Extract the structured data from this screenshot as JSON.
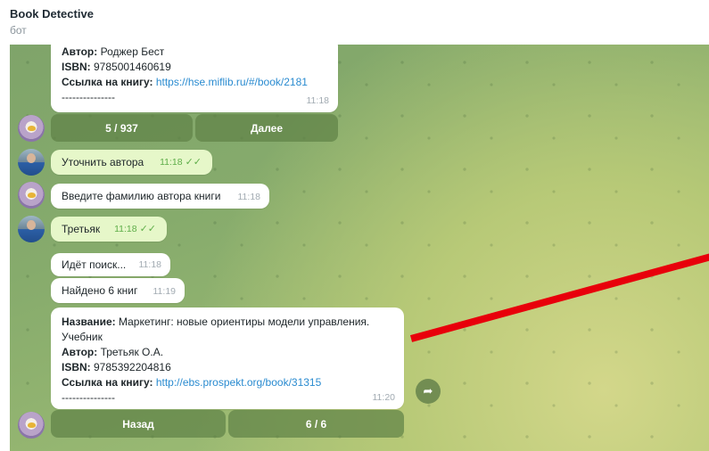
{
  "header": {
    "title": "Book Detective",
    "subtitle": "бот"
  },
  "messages": {
    "top_book": {
      "author_label": "Автор:",
      "author": " Роджер Бест",
      "isbn_label": "ISBN:",
      "isbn": " 9785001460619",
      "link_label": "Ссылка на книгу:",
      "link": "https://hse.miflib.ru/#/book/2181",
      "separator": "---------------",
      "time": "11:18"
    },
    "keyboard1": {
      "page": "5 / 937",
      "next": "Далее"
    },
    "user1": {
      "text": "Уточнить автора",
      "time": "11:18"
    },
    "bot1": {
      "text": "Введите фамилию автора книги",
      "time": "11:18"
    },
    "user2": {
      "text": "Третьяк",
      "time": "11:18"
    },
    "bot2": {
      "text": "Идёт поиск...",
      "time": "11:18"
    },
    "bot3": {
      "text": "Найдено 6 книг",
      "time": "11:19"
    },
    "book2": {
      "title_label": "Название:",
      "title": " Маркетинг: новые ориентиры модели управления.",
      "title_cont": "Учебник",
      "author_label": "Автор:",
      "author": " Третьяк О.А.",
      "isbn_label": "ISBN:",
      "isbn": " 9785392204816",
      "link_label": "Ссылка на книгу:",
      "link": "http://ebs.prospekt.org/book/31315",
      "separator": "---------------",
      "time": "11:20"
    },
    "keyboard2": {
      "back": "Назад",
      "page": "6 / 6"
    }
  },
  "icons": {
    "read_ticks": "double-check-icon",
    "share": "share-arrow-icon"
  },
  "colors": {
    "annotation_line": "#e8000b",
    "link": "#2a8bd0",
    "outgoing_bubble": "#e6f7c9"
  }
}
